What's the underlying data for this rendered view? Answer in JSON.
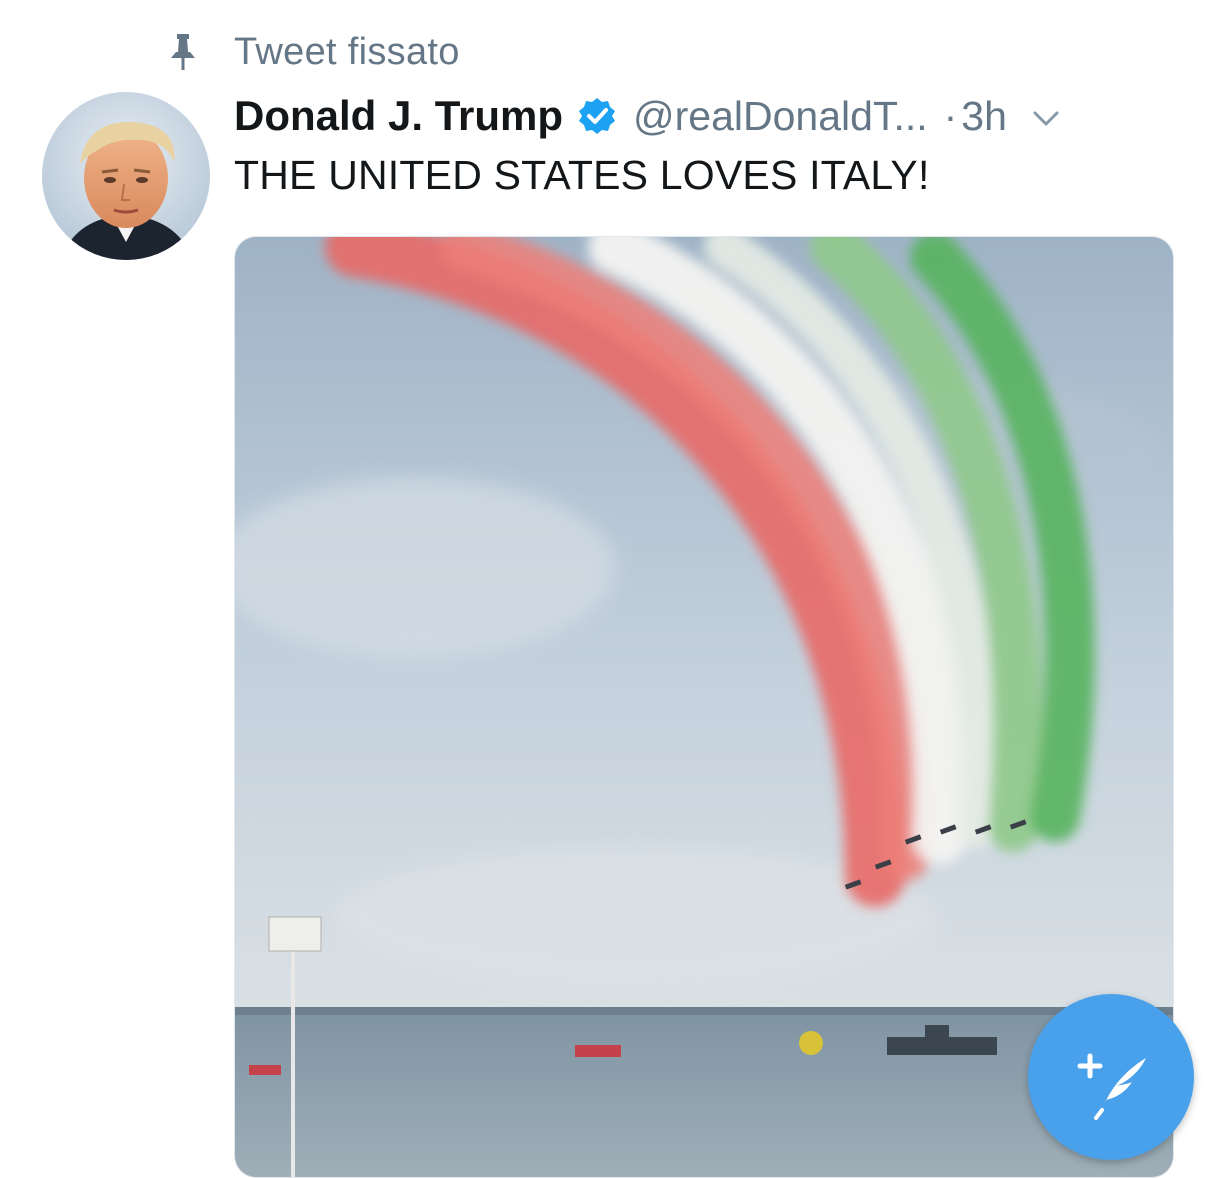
{
  "pinned": {
    "label": "Tweet fissato",
    "icon": "pin-icon"
  },
  "tweet": {
    "author": {
      "name": "Donald J. Trump",
      "handle": "@realDonaldT...",
      "verified": true
    },
    "separator": "·",
    "time": "3h",
    "text": "THE UNITED STATES LOVES ITALY!",
    "media": {
      "type": "video"
    }
  },
  "compose": {
    "icon": "compose-tweet-icon"
  },
  "colors": {
    "accent": "#4aa1eb",
    "secondary_text": "#657786",
    "primary_text": "#14171a",
    "verified": "#1da1f2"
  }
}
